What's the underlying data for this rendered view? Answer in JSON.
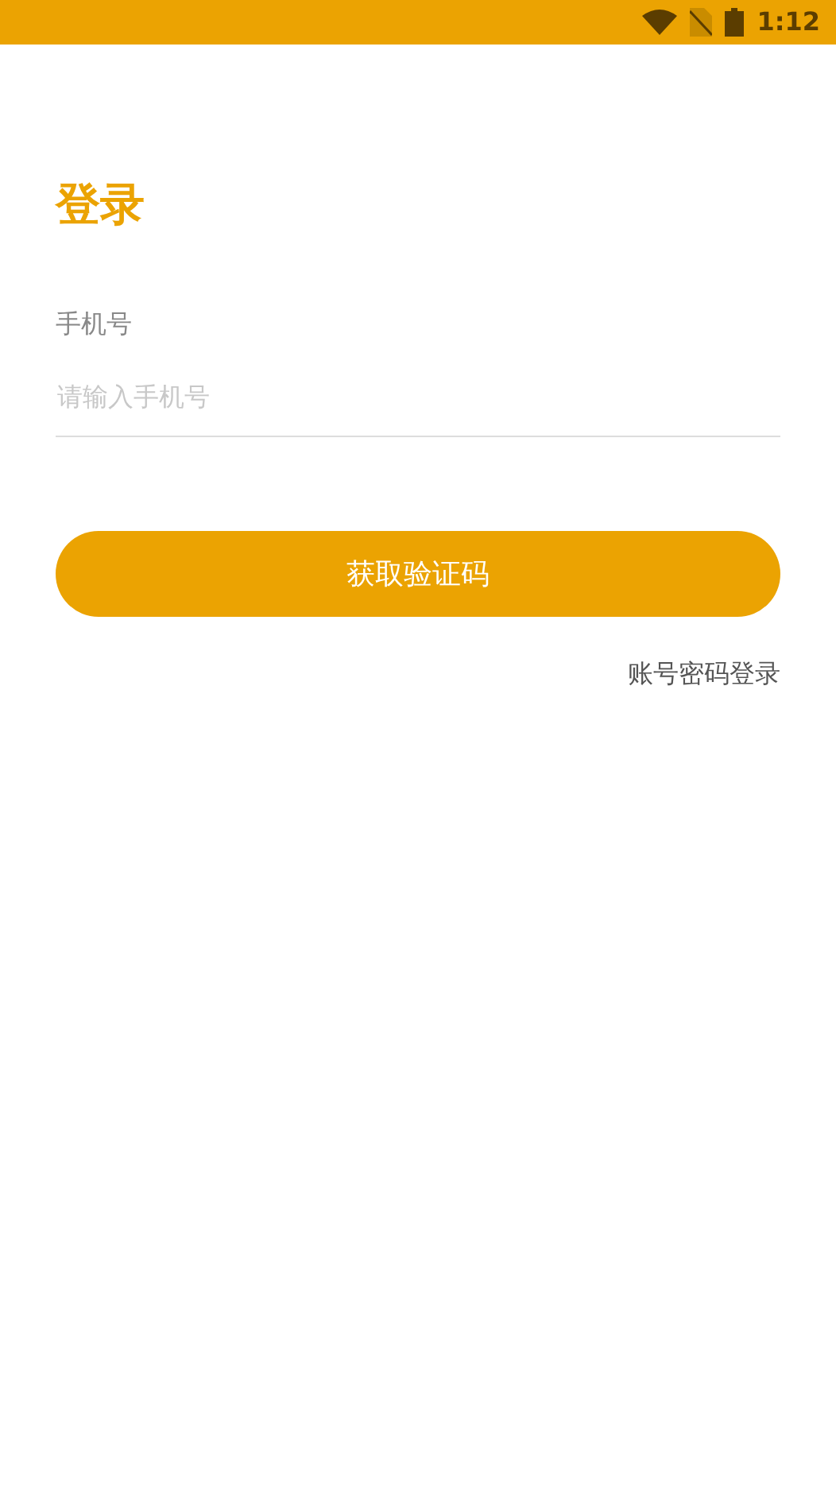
{
  "status_bar": {
    "time": "1:12"
  },
  "title": "登录",
  "phone_field": {
    "label": "手机号",
    "placeholder": "请输入手机号"
  },
  "submit_button": "获取验证码",
  "alt_login_link": "账号密码登录"
}
